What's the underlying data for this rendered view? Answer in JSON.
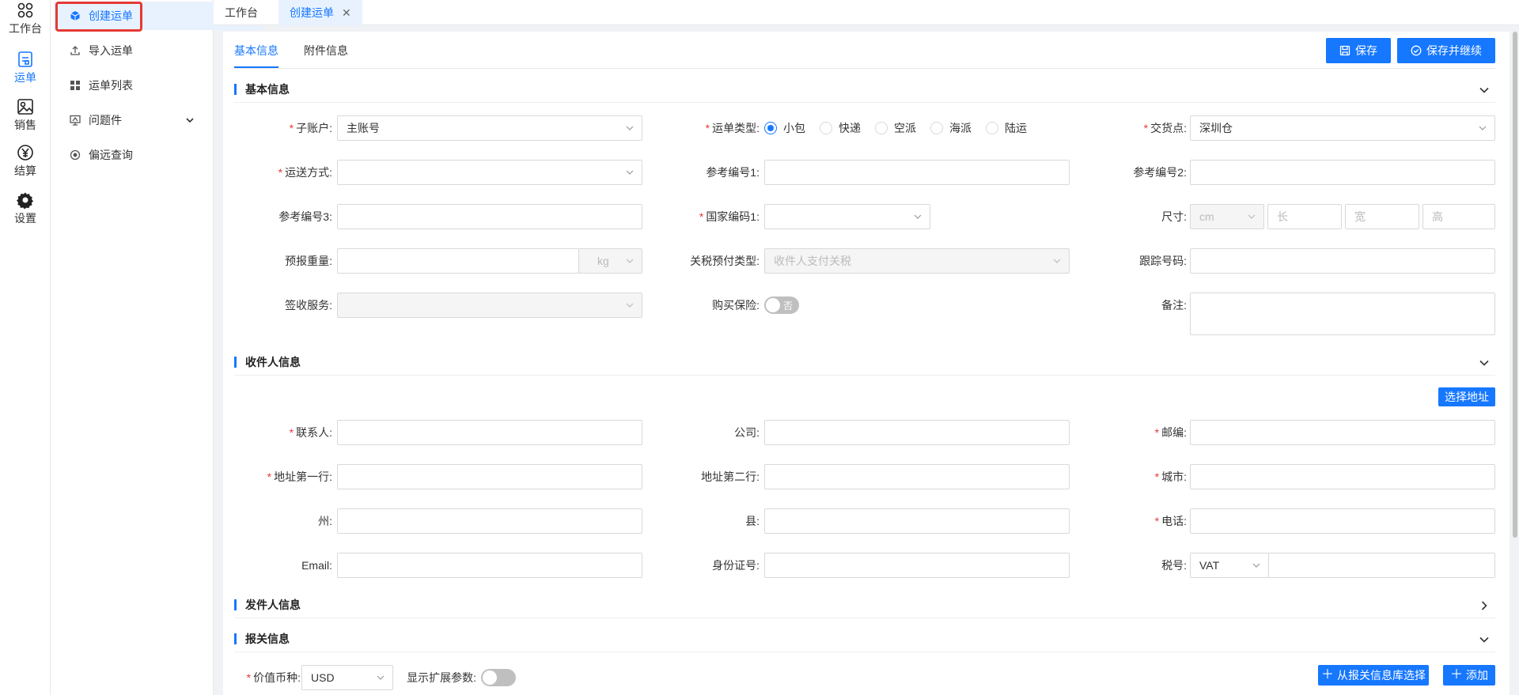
{
  "rail": {
    "items": [
      {
        "label": "工作台",
        "icon": "workbench-icon"
      },
      {
        "label": "运单",
        "icon": "waybill-icon"
      },
      {
        "label": "销售",
        "icon": "sales-icon"
      },
      {
        "label": "结算",
        "icon": "yen-icon"
      },
      {
        "label": "设置",
        "icon": "gear-icon"
      }
    ],
    "active_index": 1
  },
  "submenu": {
    "items": [
      {
        "label": "创建运单",
        "icon": "box-icon"
      },
      {
        "label": "导入运单",
        "icon": "upload-icon"
      },
      {
        "label": "运单列表",
        "icon": "grid-icon"
      },
      {
        "label": "问题件",
        "icon": "monitor-icon"
      },
      {
        "label": "偏远查询",
        "icon": "target-icon"
      }
    ]
  },
  "tabs": [
    {
      "label": "工作台"
    },
    {
      "label": "创建运单"
    }
  ],
  "page_tabs": [
    {
      "label": "基本信息"
    },
    {
      "label": "附件信息"
    }
  ],
  "actions": {
    "save": "保存",
    "save_continue": "保存并继续",
    "choose_address": "选择地址",
    "from_customs_lib": "从报关信息库选择",
    "add": "添加"
  },
  "sections": {
    "basic": "基本信息",
    "receiver": "收件人信息",
    "sender": "发件人信息",
    "customs": "报关信息"
  },
  "basic": {
    "sub_account_label": "子账户:",
    "sub_account_value": "主账号",
    "waybill_type_label": "运单类型:",
    "waybill_types": [
      "小包",
      "快递",
      "空派",
      "海派",
      "陆运"
    ],
    "delivery_point_label": "交货点:",
    "delivery_point_value": "深圳仓",
    "transport_label": "运送方式:",
    "ref1_label": "参考编号1:",
    "ref2_label": "参考编号2:",
    "ref3_label": "参考编号3:",
    "country_label": "国家编码1:",
    "size_label": "尺寸:",
    "size_unit": "cm",
    "size_length": "长",
    "size_width": "宽",
    "size_height": "高",
    "weight_label": "预报重量:",
    "weight_unit": "kg",
    "tax_type_label": "关税预付类型:",
    "tax_type_value": "收件人支付关税",
    "tracking_label": "跟踪号码:",
    "sign_label": "签收服务:",
    "insurance_label": "购买保险:",
    "insurance_off": "否",
    "remark_label": "备注:"
  },
  "receiver": {
    "contact_label": "联系人:",
    "company_label": "公司:",
    "zip_label": "邮编:",
    "addr1_label": "地址第一行:",
    "addr2_label": "地址第二行:",
    "city_label": "城市:",
    "state_label": "州:",
    "county_label": "县:",
    "phone_label": "电话:",
    "email_label": "Email:",
    "id_label": "身份证号:",
    "tax_label": "税号:",
    "tax_type": "VAT"
  },
  "customs": {
    "currency_label": "价值币种:",
    "currency_value": "USD",
    "ext_label": "显示扩展参数:"
  }
}
